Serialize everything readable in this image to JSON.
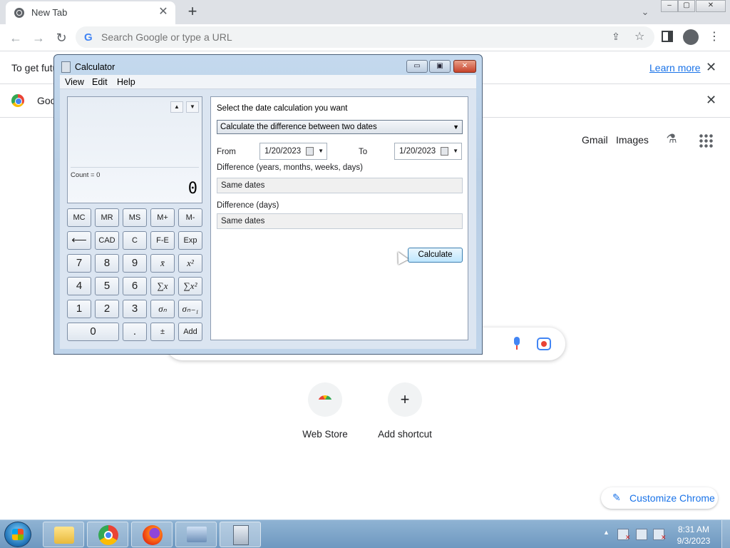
{
  "browser": {
    "tab_title": "New Tab",
    "tab_close": "✕",
    "new_tab": "+",
    "tab_search": "⌄",
    "window_controls": {
      "minimize": "–",
      "maximize": "▢",
      "close": "✕"
    },
    "nav": {
      "back": "←",
      "forward": "→",
      "reload": "↻"
    },
    "omnibox": {
      "g_glyph": "G",
      "placeholder": "Search Google or type a URL",
      "share": "⇪",
      "star": "☆"
    },
    "menu": "⋮",
    "infobar1": {
      "text": "To get futu",
      "link": "Learn more",
      "close": "✕"
    },
    "infobar2": {
      "text": "Goo",
      "close": "✕"
    }
  },
  "ntp": {
    "gmail": "Gmail",
    "images": "Images",
    "labs": "⚗",
    "shortcuts": [
      {
        "label": "Web Store"
      },
      {
        "label": "Add shortcut",
        "glyph": "+"
      }
    ],
    "customize": {
      "icon": "✎",
      "label": "Customize Chrome"
    }
  },
  "calculator": {
    "title": "Calculator",
    "controls": {
      "minimize": "▭",
      "maximize": "▣",
      "close": "✕"
    },
    "menu": {
      "view": "View",
      "edit": "Edit",
      "help": "Help"
    },
    "display": {
      "up": "▲",
      "down": "▼",
      "count": "Count = 0",
      "value": "0"
    },
    "keys": {
      "mc": "MC",
      "mr": "MR",
      "ms": "MS",
      "mplus": "M+",
      "mminus": "M-",
      "back": "⟵",
      "cad": "CAD",
      "c": "C",
      "fe": "F-E",
      "exp": "Exp",
      "n7": "7",
      "n8": "8",
      "n9": "9",
      "mean": "x̄",
      "meansq": "x²",
      "n4": "4",
      "n5": "5",
      "n6": "6",
      "sum": "∑x",
      "sumsq": "∑x²",
      "n1": "1",
      "n2": "2",
      "n3": "3",
      "sigma": "σₙ",
      "sigma1": "σₙ₋₁",
      "n0": "0",
      "dot": ".",
      "pm": "±",
      "add": "Add"
    },
    "date": {
      "prompt": "Select the date calculation you want",
      "mode": "Calculate the difference between two dates",
      "mode_arrow": "▼",
      "from_label": "From",
      "from_value": "1/20/2023",
      "to_label": "To",
      "to_value": "1/20/2023",
      "date_dropdown": "▼",
      "diff_label": "Difference (years, months, weeks, days)",
      "diff_value": "Same dates",
      "diff_days_label": "Difference (days)",
      "diff_days_value": "Same dates",
      "calculate": "Calculate"
    }
  },
  "taskbar": {
    "tray_up": "▲",
    "tray_x": "✕",
    "time": "8:31 AM",
    "date": "9/3/2023"
  }
}
